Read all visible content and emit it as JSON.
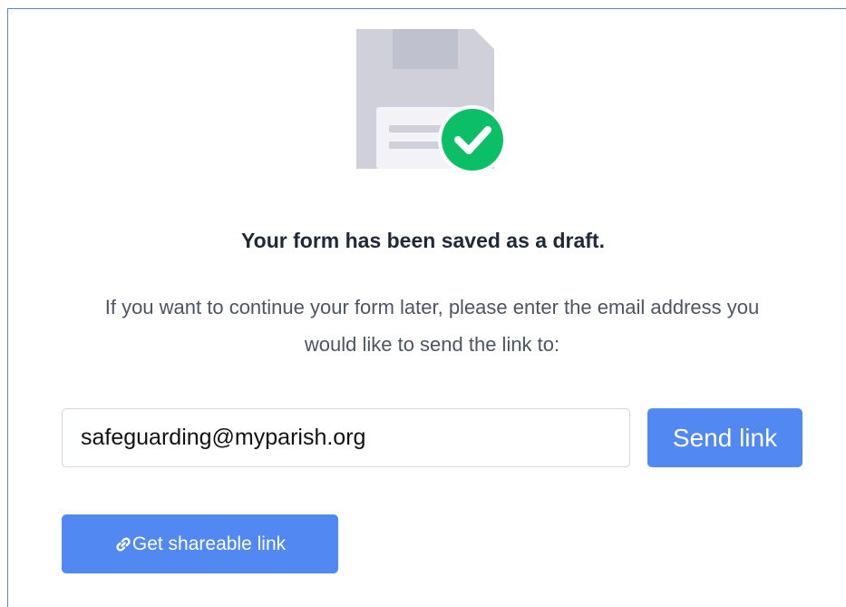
{
  "icons": {
    "illustration": "floppy-disk-icon",
    "status": "check-circle-icon",
    "share": "link-icon"
  },
  "colors": {
    "accent": "#5188f2",
    "success": "#0bbf67",
    "disk": "#cfd0da"
  },
  "message": {
    "title": "Your form has been saved as a draft.",
    "description": "If you want to continue your form later, please enter the email address you would like to send the link to:"
  },
  "email_form": {
    "email_value": "safeguarding@myparish.org",
    "send_label": "Send link"
  },
  "share": {
    "label": "Get shareable link"
  }
}
